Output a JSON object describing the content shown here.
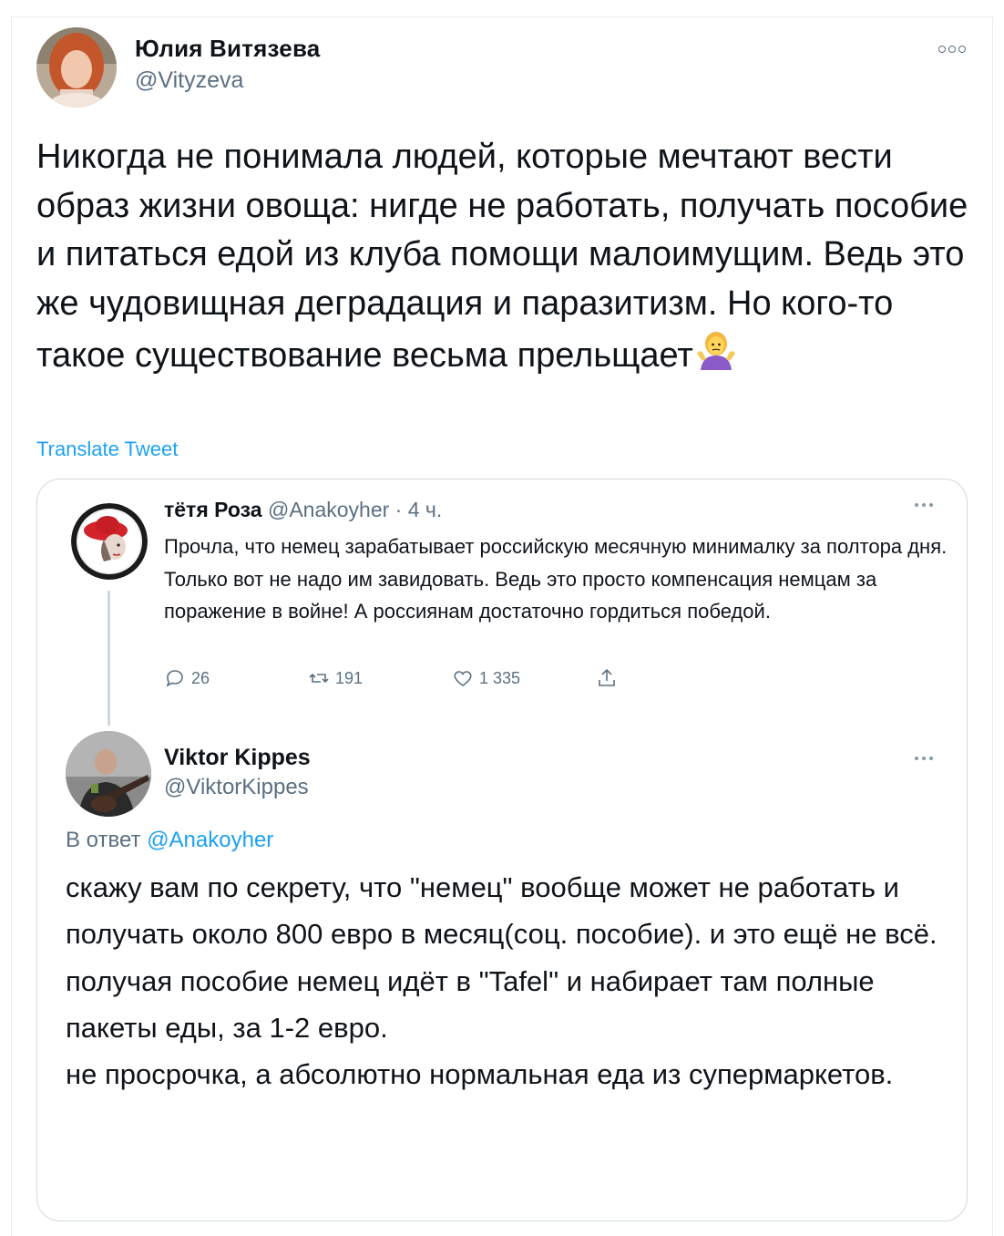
{
  "tweet": {
    "author_name": "Юлия Витязева",
    "author_handle": "@Vityzeva",
    "text": "Никогда не понимала людей, которые мечтают вести образ жизни овоща: нигде не работать, получать пособие и питаться едой из клуба помощи малоимущим. Ведь это же чудовищная деградация и паразитизм. Но кого-то такое существование весьма прельщает",
    "emoji": "person-shrugging-emoji",
    "translate_label": "Translate Tweet"
  },
  "quoted": {
    "author_name": "тётя Роза",
    "author_handle": "@Anakoyher",
    "separator": " · ",
    "time": "4 ч.",
    "text": "Прочла, что немец зарабатывает российскую месячную минималку за полтора дня. Только вот не надо им завидовать. Ведь это просто компенсация немцам за поражение в войне! А россиянам достаточно гордиться победой.",
    "replies": "26",
    "retweets": "191",
    "likes": "1 335"
  },
  "reply": {
    "author_name": "Viktor Kippes",
    "author_handle": "@ViktorKippes",
    "reply_prefix": "В ответ",
    "reply_to": "@Anakoyher",
    "text": "скажу вам по секрету, что \"немец\" вообще может не работать и получать около 800 евро в месяц(соц. пособие). и это ещё не всё.\nполучая пособие немец идёт в \"Tafel\" и набирает там полные пакеты еды, за 1-2 евро.\nне просрочка, а абсолютно нормальная еда из супермаркетов."
  },
  "colors": {
    "link": "#1da1f2",
    "muted": "#5b7083",
    "border": "#cfd9de"
  }
}
